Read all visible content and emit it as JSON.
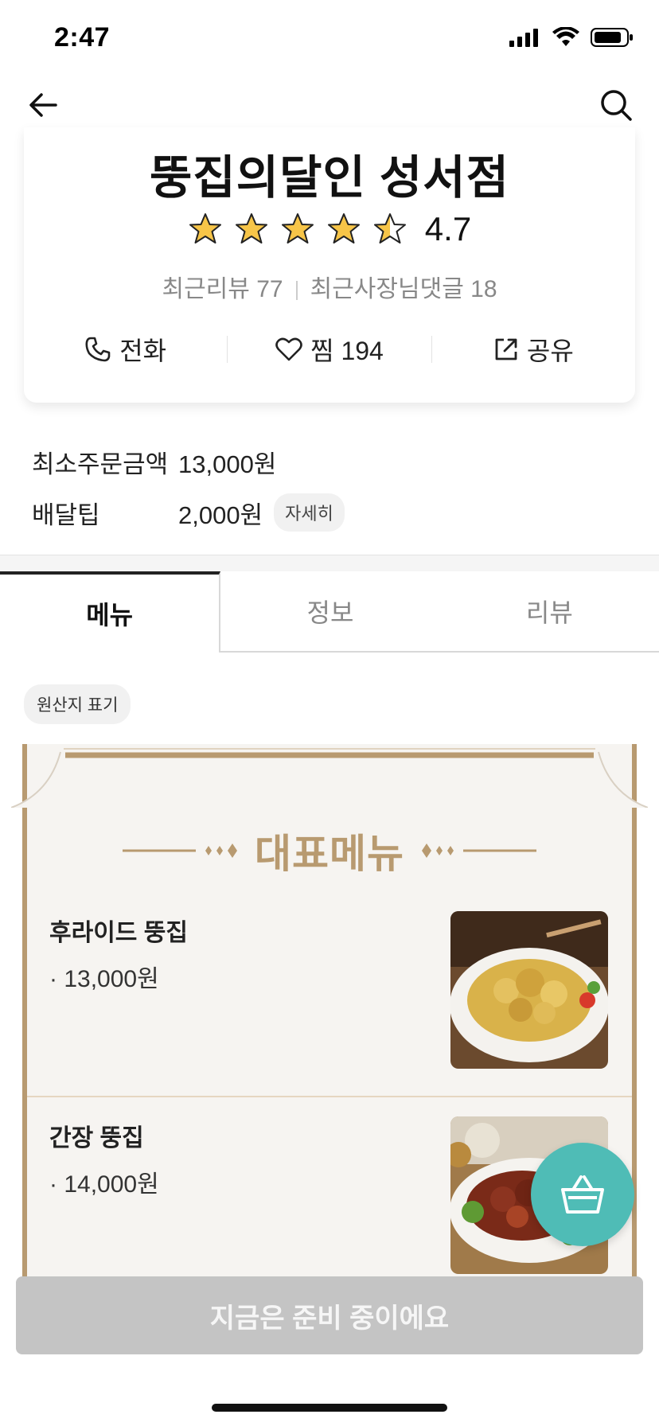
{
  "status_bar": {
    "time": "2:47",
    "icons": [
      "signal-icon",
      "wifi-icon",
      "battery-icon"
    ]
  },
  "nav": {
    "back_icon": "arrow-left-icon",
    "search_icon": "search-icon"
  },
  "store": {
    "name": "뚱집의달인 성서점",
    "rating": "4.7",
    "rating_stars": 4.5,
    "recent_reviews": "최근리뷰 77",
    "owner_replies": "최근사장님댓글 18",
    "actions": {
      "call": "전화",
      "favorite": "찜 194",
      "share": "공유"
    }
  },
  "info": {
    "min_order_label": "최소주문금액",
    "min_order_value": "13,000원",
    "delivery_tip_label": "배달팁",
    "delivery_tip_value": "2,000원",
    "detail_button": "자세히"
  },
  "tabs": [
    {
      "label": "메뉴",
      "active": true
    },
    {
      "label": "정보",
      "active": false
    },
    {
      "label": "리뷰",
      "active": false
    }
  ],
  "origin_chip": "원산지 표기",
  "board": {
    "title": "대표메뉴",
    "items": [
      {
        "name": "후라이드 뚱집",
        "price": "· 13,000원"
      },
      {
        "name": "간장 뚱집",
        "price": "· 14,000원"
      }
    ]
  },
  "order_bar": {
    "label": "지금은 준비 중이에요"
  },
  "colors": {
    "accent_gold": "#b89a70",
    "cart_teal": "#4fbcb6",
    "disabled_gray": "#c4c4c4",
    "star_yellow": "#f7c548"
  }
}
